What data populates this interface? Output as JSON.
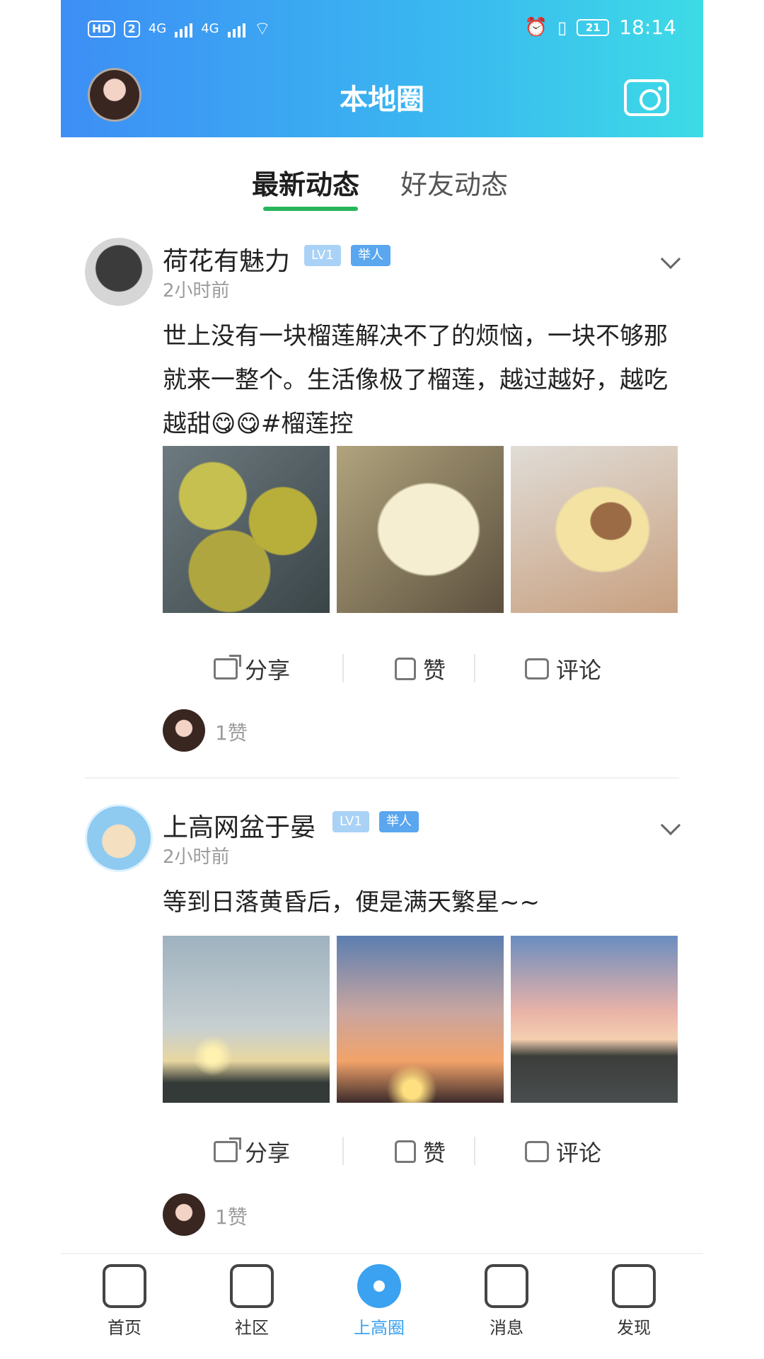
{
  "status_bar": {
    "left_badges": [
      "HD",
      "2"
    ],
    "network_left": "4G",
    "network_right": "4G",
    "battery": "21",
    "time": "18:14"
  },
  "header": {
    "title": "本地圈",
    "camera_icon": "camera-icon",
    "avatar_icon": "avatar"
  },
  "tabs": [
    {
      "label": "最新动态",
      "active": true
    },
    {
      "label": "好友动态",
      "active": false
    }
  ],
  "posts": [
    {
      "author": "荷花有魅力",
      "level": "LV1",
      "role": "举人",
      "time": "2小时前",
      "text": "世上没有一块榴莲解决不了的烦恼，一块不够那就来一整个。生活像极了榴莲，越过越好，越吃越甜😋😋#榴莲控",
      "images": [
        "durian-fruits",
        "durian-flesh",
        "durian-in-hand"
      ],
      "actions": {
        "share": "分享",
        "like": "赞",
        "comment": "评论"
      },
      "likes_count": "1赞"
    },
    {
      "author": "上高网盆于晏",
      "level": "LV1",
      "role": "举人",
      "time": "2小时前",
      "text": "等到日落黄昏后，便是满天繁星~~",
      "images": [
        "sunset-sky",
        "sunset-buildings",
        "sunset-road"
      ],
      "actions": {
        "share": "分享",
        "like": "赞",
        "comment": "评论"
      },
      "likes_count": "1赞"
    }
  ],
  "bottom_nav": [
    {
      "label": "首页",
      "icon": "home-icon",
      "active": false
    },
    {
      "label": "社区",
      "icon": "community-icon",
      "active": false
    },
    {
      "label": "上高圈",
      "icon": "circle-icon",
      "active": true
    },
    {
      "label": "消息",
      "icon": "message-icon",
      "active": false
    },
    {
      "label": "发现",
      "icon": "rocket-icon",
      "active": false
    }
  ],
  "colors": {
    "header_gradient_start": "#3d8ef5",
    "header_gradient_end": "#3ddbe6",
    "tab_indicator": "#27b55b",
    "nav_active": "#3aa2f0"
  }
}
